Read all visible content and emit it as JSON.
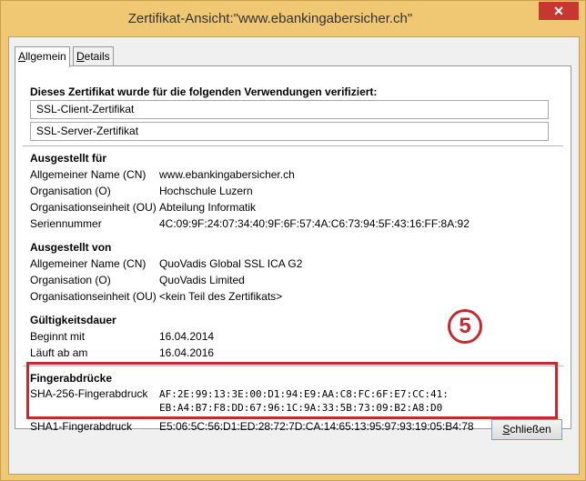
{
  "window": {
    "title": "Zertifikat-Ansicht:\"www.ebankingabersicher.ch\"",
    "close_glyph": "✕"
  },
  "tabs": [
    {
      "accel": "A",
      "rest": "llgemein"
    },
    {
      "accel": "D",
      "rest": "etails"
    }
  ],
  "usage": {
    "heading": "Dieses Zertifikat wurde für die folgenden Verwendungen verifiziert:",
    "items": [
      "SSL-Client-Zertifikat",
      "SSL-Server-Zertifikat"
    ]
  },
  "issued_to": {
    "heading": "Ausgestellt für",
    "rows": [
      {
        "label": "Allgemeiner Name (CN)",
        "value": "www.ebankingabersicher.ch"
      },
      {
        "label": "Organisation (O)",
        "value": "Hochschule Luzern"
      },
      {
        "label": "Organisationseinheit (OU)",
        "value": "Abteilung Informatik"
      },
      {
        "label": "Seriennummer",
        "value": "4C:09:9F:24:07:34:40:9F:6F:57:4A:C6:73:94:5F:43:16:FF:8A:92"
      }
    ]
  },
  "issued_by": {
    "heading": "Ausgestellt von",
    "rows": [
      {
        "label": "Allgemeiner Name (CN)",
        "value": "QuoVadis Global SSL ICA G2"
      },
      {
        "label": "Organisation (O)",
        "value": "QuoVadis Limited"
      },
      {
        "label": "Organisationseinheit (OU)",
        "value": "<kein Teil des Zertifikats>"
      }
    ]
  },
  "validity": {
    "heading": "Gültigkeitsdauer",
    "rows": [
      {
        "label": "Beginnt mit",
        "value": "16.04.2014"
      },
      {
        "label": "Läuft ab am",
        "value": "16.04.2016"
      }
    ]
  },
  "fingerprints": {
    "heading": "Fingerabdrücke",
    "sha256_label": "SHA-256-Fingerabdruck",
    "sha256_line1": "AF:2E:99:13:3E:00:D1:94:E9:AA:C8:FC:6F:E7:CC:41:",
    "sha256_line2": "EB:A4:B7:F8:DD:67:96:1C:9A:33:5B:73:09:B2:A8:D0",
    "sha1_label": "SHA1-Fingerabdruck",
    "sha1_value": "E5:06:5C:56:D1:ED:28:72:7D:CA:14:65:13:95:97:93:19:05:B4:78"
  },
  "annotation": {
    "number": "5",
    "color": "#c62a2f"
  },
  "buttons": {
    "close_accel": "S",
    "close_rest": "chließen"
  }
}
